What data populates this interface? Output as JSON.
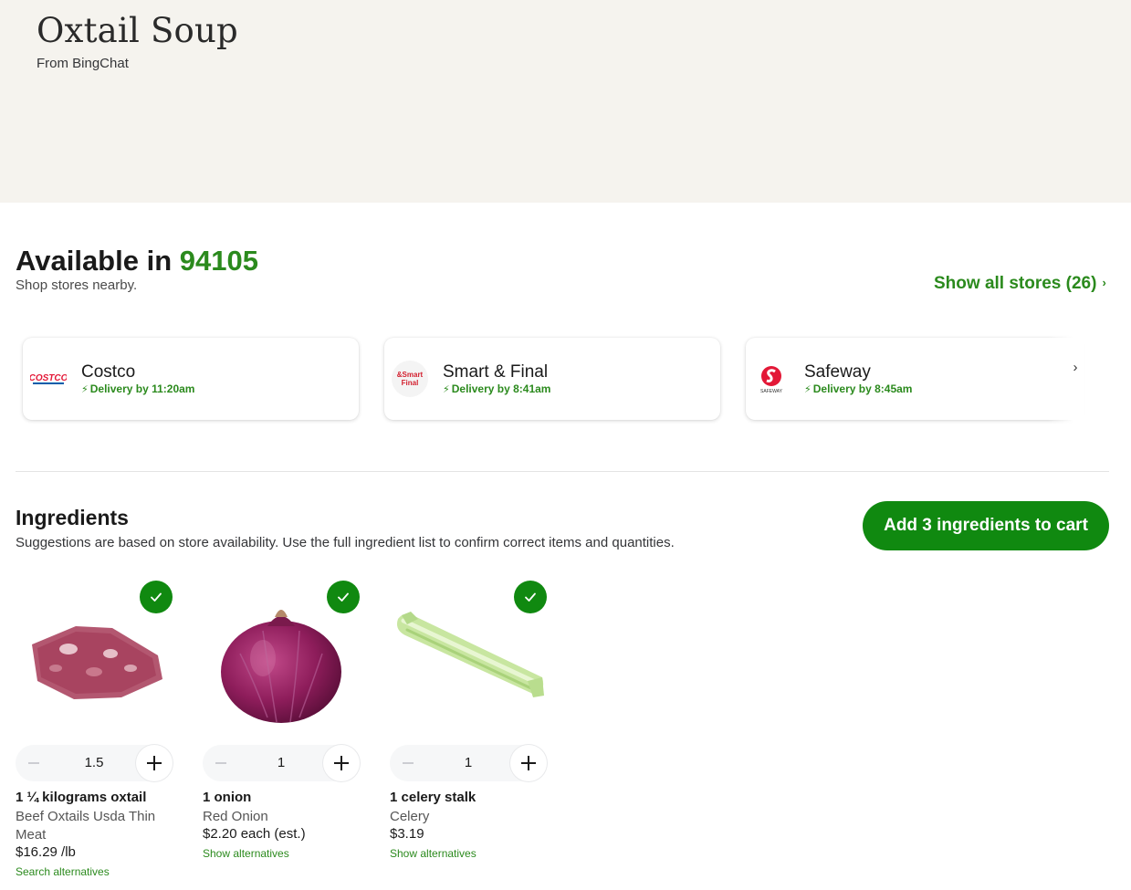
{
  "hero": {
    "title": "Oxtail Soup",
    "subtitle": "From BingChat"
  },
  "availability": {
    "prefix": "Available in",
    "zip": "94105",
    "subtitle": "Shop stores nearby.",
    "show_all": "Show all stores (26)"
  },
  "stores": [
    {
      "name": "Costco",
      "delivery": "Delivery by 11:20am",
      "logo_text": "COSTCO"
    },
    {
      "name": "Smart & Final",
      "delivery": "Delivery by 8:41am",
      "logo_text": "&Smart Final"
    },
    {
      "name": "Safeway",
      "delivery": "Delivery by 8:45am",
      "logo_text": "SAFEWAY"
    }
  ],
  "ingredients": {
    "title": "Ingredients",
    "subtitle": "Suggestions are based on store availability. Use the full ingredient list to confirm correct items and quantities.",
    "add_button": "Add 3 ingredients to cart",
    "items": [
      {
        "quantity": "1.5",
        "recipe_qty": "1 ¼ kilograms oxtail",
        "product": "Beef Oxtails Usda Thin Meat",
        "price": "$16.29 /lb",
        "link": "Search alternatives",
        "selected": true
      },
      {
        "quantity": "1",
        "recipe_qty": "1 onion",
        "product": "Red Onion",
        "price": "$2.20 each (est.)",
        "link": "Show alternatives",
        "selected": true
      },
      {
        "quantity": "1",
        "recipe_qty": "1 celery stalk",
        "product": "Celery",
        "price": "$3.19",
        "link": "Show alternatives",
        "selected": true
      }
    ]
  },
  "colors": {
    "accent_green": "#108910",
    "link_green": "#2b8a1d",
    "hero_bg": "#f5f3ee"
  }
}
